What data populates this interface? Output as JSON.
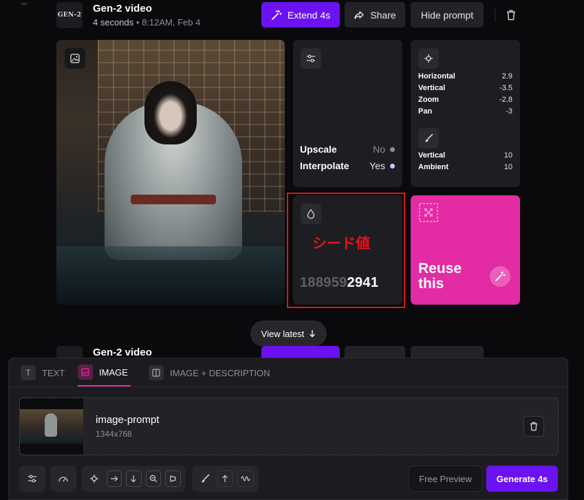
{
  "video": {
    "logo_text": "GEN-2",
    "title": "Gen-2 video",
    "duration": "4 seconds",
    "timestamp": "8:12AM, Feb 4"
  },
  "actions": {
    "extend_label": "Extend 4s",
    "share_label": "Share",
    "hide_prompt_label": "Hide prompt"
  },
  "settings": {
    "upscale_label": "Upscale",
    "upscale_value": "No",
    "interpolate_label": "Interpolate",
    "interpolate_value": "Yes"
  },
  "camera": {
    "rows": [
      {
        "label": "Horizontal",
        "value": "2.9"
      },
      {
        "label": "Vertical",
        "value": "-3.5"
      },
      {
        "label": "Zoom",
        "value": "-2.8"
      },
      {
        "label": "Pan",
        "value": "-3"
      }
    ],
    "motion_rows": [
      {
        "label": "Vertical",
        "value": "10"
      },
      {
        "label": "Ambient",
        "value": "10"
      }
    ]
  },
  "seed": {
    "annotation": "シード値",
    "prefix": "188959",
    "suffix": "2941"
  },
  "reuse": {
    "line1": "Reuse",
    "line2": "this"
  },
  "view_latest_label": "View latest",
  "second_video": {
    "title": "Gen-2 video"
  },
  "prompt_panel": {
    "tabs": [
      {
        "icon": "T",
        "label": "TEXT"
      },
      {
        "icon": "img",
        "label": "IMAGE"
      },
      {
        "icon": "split",
        "label": "IMAGE + DESCRIPTION"
      }
    ],
    "asset": {
      "name": "image-prompt",
      "size": "1344x768"
    },
    "free_preview_label": "Free Preview",
    "generate_label": "Generate 4s"
  },
  "colors": {
    "accent_purple": "#6b12f0",
    "reuse_pink": "#e32ba4",
    "annotation_red": "#e0141b"
  }
}
